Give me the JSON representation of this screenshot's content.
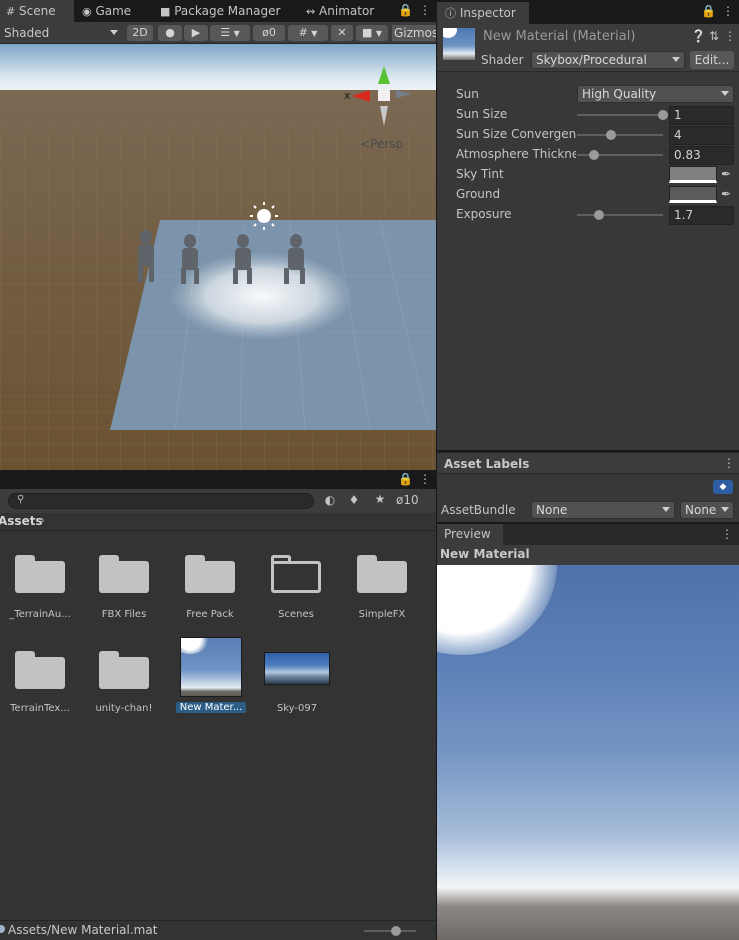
{
  "scene_tabs": {
    "scene": "Scene",
    "game": "Game",
    "package_manager": "Package Manager",
    "animator": "Animator"
  },
  "scene_toolbar": {
    "shading_mode": "Shaded",
    "mode_2d": "2D",
    "hidden_count": "0",
    "gizmos": "Gizmos"
  },
  "gizmo": {
    "x_label": "x",
    "persp_label": "Persp"
  },
  "inspector": {
    "tab": "Inspector",
    "material_name": "New Material (Material)",
    "shader_label": "Shader",
    "shader_value": "Skybox/Procedural",
    "edit_button": "Edit...",
    "properties": {
      "sun": {
        "label": "Sun",
        "value": "High Quality"
      },
      "sun_size": {
        "label": "Sun Size",
        "value": "1"
      },
      "sun_size_convergence": {
        "label": "Sun Size Convergenc",
        "value": "4"
      },
      "atmosphere_thickness": {
        "label": "Atmosphere Thicknes",
        "value": "0.83"
      },
      "sky_tint": {
        "label": "Sky Tint"
      },
      "ground": {
        "label": "Ground"
      },
      "exposure": {
        "label": "Exposure",
        "value": "1.7"
      }
    },
    "sliders": {
      "sun_size": 1.0,
      "sun_size_convergence": 0.4,
      "atmosphere_thickness": 0.2,
      "exposure": 0.25
    },
    "colors": {
      "sky_tint": "#808080",
      "ground": "#5b5b5b"
    }
  },
  "asset_labels": {
    "title": "Asset Labels",
    "assetbundle_label": "AssetBundle",
    "assetbundle_value": "None",
    "variant_value": "None"
  },
  "preview": {
    "tab": "Preview",
    "title": "New Material"
  },
  "project": {
    "hidden_count": "10",
    "breadcrumb": "Assets",
    "items": [
      {
        "label": "_TerrainAu...",
        "type": "folder"
      },
      {
        "label": "FBX Files",
        "type": "folder"
      },
      {
        "label": "Free Pack",
        "type": "folder"
      },
      {
        "label": "Scenes",
        "type": "folder-empty"
      },
      {
        "label": "SimpleFX",
        "type": "folder"
      },
      {
        "label": "TerrainTex...",
        "type": "folder"
      },
      {
        "label": "unity-chan!",
        "type": "folder"
      },
      {
        "label": "New Mater...",
        "type": "material"
      },
      {
        "label": "Sky-097",
        "type": "texture"
      }
    ],
    "status_path": "Assets/New Material.mat"
  }
}
